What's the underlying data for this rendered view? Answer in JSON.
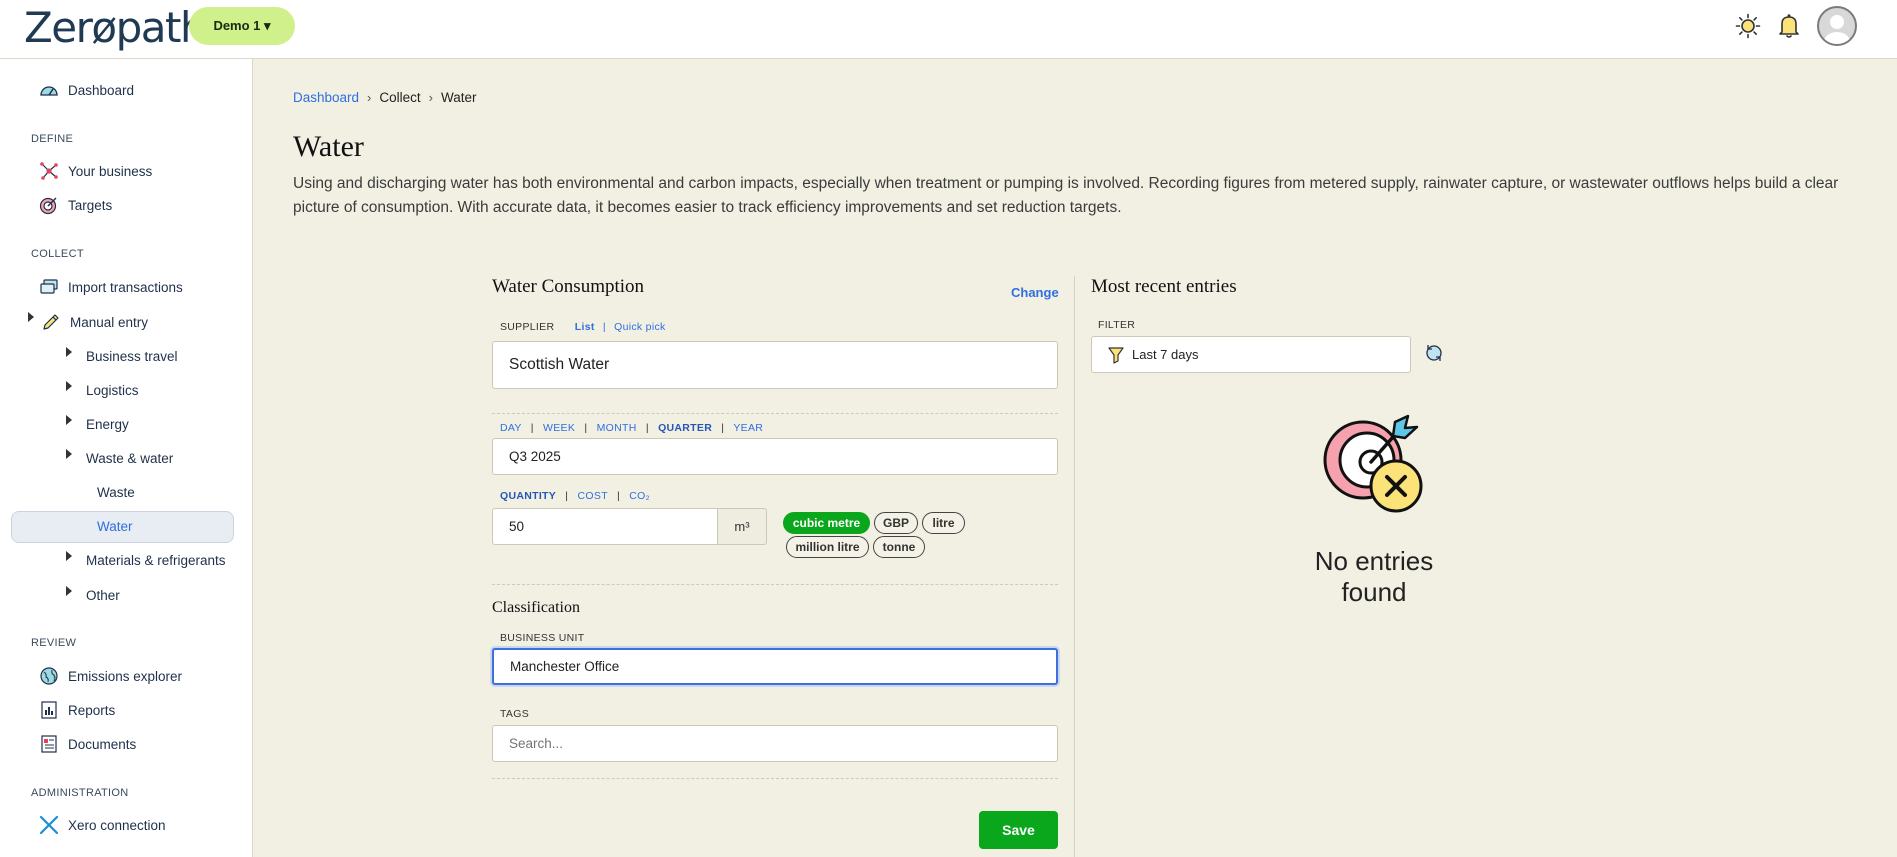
{
  "header": {
    "logo_text": "Zerøpath",
    "demo_label": "Demo 1 ▾"
  },
  "sidebar": {
    "dashboard": "Dashboard",
    "sections": {
      "define": "DEFINE",
      "collect": "COLLECT",
      "review": "REVIEW",
      "administration": "ADMINISTRATION"
    },
    "items": {
      "your_business": "Your business",
      "targets": "Targets",
      "import_transactions": "Import transactions",
      "manual_entry": "Manual entry",
      "business_travel": "Business travel",
      "logistics": "Logistics",
      "energy": "Energy",
      "waste_water": "Waste & water",
      "waste": "Waste",
      "water": "Water",
      "materials": "Materials & refrigerants",
      "other": "Other",
      "emissions_explorer": "Emissions explorer",
      "reports": "Reports",
      "documents": "Documents",
      "xero": "Xero connection"
    }
  },
  "breadcrumb": {
    "dashboard": "Dashboard",
    "collect": "Collect",
    "water": "Water",
    "sep": "›"
  },
  "page": {
    "title": "Water",
    "description": "Using and discharging water has both environmental and carbon impacts, especially when treatment or pumping is involved. Recording figures from metered supply, rainwater capture, or wastewater outflows helps build a clear picture of consumption. With accurate data, it becomes easier to track efficiency improvements and set reduction targets."
  },
  "form": {
    "title": "Water Consumption",
    "change": "Change",
    "supplier_label": "SUPPLIER",
    "supplier_list": "List",
    "supplier_quick": "Quick pick",
    "supplier_value": "Scottish Water",
    "periods": [
      "DAY",
      "WEEK",
      "MONTH",
      "QUARTER",
      "YEAR"
    ],
    "period_sep": "|",
    "period_value": "Q3 2025",
    "measure_tabs": [
      "QUANTITY",
      "COST",
      "CO₂"
    ],
    "quantity_value": "50",
    "quantity_unit": "m³",
    "units": [
      "cubic metre",
      "GBP",
      "litre",
      "million litre",
      "tonne"
    ],
    "classification_title": "Classification",
    "business_unit_label": "BUSINESS UNIT",
    "business_unit_value": "Manchester Office",
    "tags_label": "TAGS",
    "tags_placeholder": "Search...",
    "save": "Save"
  },
  "recent": {
    "title": "Most recent entries",
    "filter_label": "FILTER",
    "filter_value": "Last 7 days",
    "empty": "No entries found"
  },
  "colors": {
    "accent": "#2f6fe0",
    "save_green": "#0aa61c",
    "active_unit": "#0aa61c",
    "demo_bg": "#cff08a",
    "page_bg": "#f2f0e3"
  }
}
